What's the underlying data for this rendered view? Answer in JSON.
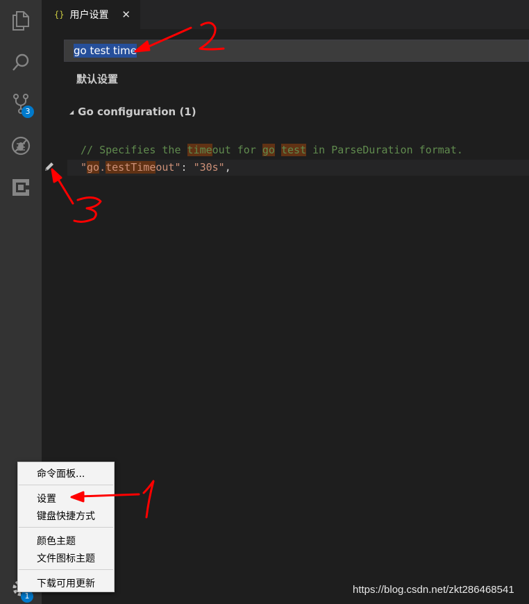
{
  "activity_bar": {
    "source_control_badge": "3",
    "manage_badge": "1",
    "icons": [
      "explorer-icon",
      "search-icon",
      "source-control-icon",
      "debug-icon",
      "extensions-icon",
      "gear-icon"
    ]
  },
  "tab": {
    "icon": "{}",
    "title": "用户设置",
    "close": "✕"
  },
  "search": {
    "value": "go test time"
  },
  "default_settings_label": "默认设置",
  "section": {
    "title": "Go configuration (1)"
  },
  "code": {
    "comment_parts": [
      "// Specifies the ",
      "time",
      "out for ",
      "go",
      " ",
      "test",
      " in ParseDuration format."
    ],
    "key_parts": [
      "\"",
      "go",
      ".",
      "testTime",
      "out",
      "\""
    ],
    "colon": ": ",
    "value": "\"30s\"",
    "comma": ","
  },
  "context_menu": {
    "items": [
      "命令面板...",
      "设置",
      "键盘快捷方式",
      "颜色主题",
      "文件图标主题",
      "下载可用更新"
    ]
  },
  "annotations": [
    "1",
    "2",
    "3"
  ],
  "watermark": "https://blog.csdn.net/zkt286468541",
  "colors": {
    "activity_bar": "#333333",
    "editor_bg": "#1e1e1e",
    "tab_bar": "#252526",
    "badge": "#007acc",
    "selection": "#264f9a",
    "match_highlight": "#613214",
    "comment": "#608b4e",
    "string": "#ce9178",
    "annotation": "#ff0000"
  }
}
